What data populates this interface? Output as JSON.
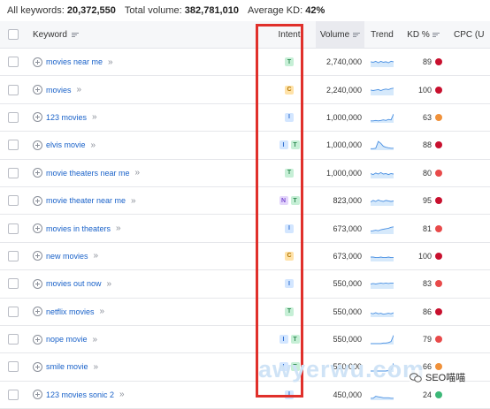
{
  "summary": {
    "keywords_label": "All keywords:",
    "keywords_value": "20,372,550",
    "volume_label": "Total volume:",
    "volume_value": "382,781,010",
    "kd_label": "Average KD:",
    "kd_value": "42%"
  },
  "headers": {
    "keyword": "Keyword",
    "intent": "Intent",
    "volume": "Volume",
    "trend": "Trend",
    "kd": "KD %",
    "cpc": "CPC (U"
  },
  "intent_colors": {
    "T": {
      "bg": "#c6efd6",
      "fg": "#2f8a52"
    },
    "C": {
      "bg": "#ffe2a8",
      "fg": "#b07500"
    },
    "I": {
      "bg": "#d3e6ff",
      "fg": "#2f6fd1"
    },
    "N": {
      "bg": "#e4d6fb",
      "fg": "#7a4bd1"
    }
  },
  "rows": [
    {
      "keyword": "movies near me",
      "intents": [
        "T"
      ],
      "volume": "2,740,000",
      "kd": "89",
      "kd_color": "#c8102e",
      "trend": [
        0.55,
        0.5,
        0.6,
        0.45,
        0.6,
        0.5,
        0.55,
        0.45,
        0.6,
        0.55
      ]
    },
    {
      "keyword": "movies",
      "intents": [
        "C"
      ],
      "volume": "2,240,000",
      "kd": "100",
      "kd_color": "#c8102e",
      "trend": [
        0.55,
        0.5,
        0.55,
        0.6,
        0.5,
        0.6,
        0.65,
        0.6,
        0.7,
        0.75
      ]
    },
    {
      "keyword": "123 movies",
      "intents": [
        "I"
      ],
      "volume": "1,000,000",
      "kd": "63",
      "kd_color": "#f0913a",
      "trend": [
        0.2,
        0.2,
        0.25,
        0.2,
        0.25,
        0.3,
        0.25,
        0.35,
        0.3,
        0.9
      ]
    },
    {
      "keyword": "elvis movie",
      "intents": [
        "I",
        "T"
      ],
      "volume": "1,000,000",
      "kd": "88",
      "kd_color": "#c8102e",
      "trend": [
        0.15,
        0.15,
        0.2,
        0.9,
        0.7,
        0.4,
        0.3,
        0.25,
        0.2,
        0.2
      ]
    },
    {
      "keyword": "movie theaters near me",
      "intents": [
        "T"
      ],
      "volume": "1,000,000",
      "kd": "80",
      "kd_color": "#e84a4a",
      "trend": [
        0.5,
        0.4,
        0.55,
        0.45,
        0.6,
        0.45,
        0.5,
        0.4,
        0.5,
        0.45
      ]
    },
    {
      "keyword": "movie theater near me",
      "intents": [
        "N",
        "T"
      ],
      "volume": "823,000",
      "kd": "95",
      "kd_color": "#c8102e",
      "trend": [
        0.4,
        0.55,
        0.45,
        0.6,
        0.5,
        0.45,
        0.55,
        0.5,
        0.45,
        0.5
      ]
    },
    {
      "keyword": "movies in theaters",
      "intents": [
        "I"
      ],
      "volume": "673,000",
      "kd": "81",
      "kd_color": "#e84a4a",
      "trend": [
        0.3,
        0.35,
        0.4,
        0.35,
        0.45,
        0.5,
        0.55,
        0.6,
        0.7,
        0.75
      ]
    },
    {
      "keyword": "new movies",
      "intents": [
        "C"
      ],
      "volume": "673,000",
      "kd": "100",
      "kd_color": "#c8102e",
      "trend": [
        0.45,
        0.45,
        0.4,
        0.4,
        0.45,
        0.4,
        0.4,
        0.45,
        0.4,
        0.4
      ]
    },
    {
      "keyword": "movies out now",
      "intents": [
        "I"
      ],
      "volume": "550,000",
      "kd": "83",
      "kd_color": "#e84a4a",
      "trend": [
        0.5,
        0.55,
        0.5,
        0.55,
        0.6,
        0.55,
        0.6,
        0.55,
        0.6,
        0.6
      ]
    },
    {
      "keyword": "netflix movies",
      "intents": [
        "T"
      ],
      "volume": "550,000",
      "kd": "86",
      "kd_color": "#c8102e",
      "trend": [
        0.4,
        0.35,
        0.45,
        0.35,
        0.4,
        0.3,
        0.35,
        0.4,
        0.35,
        0.45
      ]
    },
    {
      "keyword": "nope movie",
      "intents": [
        "I",
        "T"
      ],
      "volume": "550,000",
      "kd": "79",
      "kd_color": "#e84a4a",
      "trend": [
        0.1,
        0.1,
        0.1,
        0.1,
        0.1,
        0.15,
        0.15,
        0.2,
        0.3,
        0.95
      ]
    },
    {
      "keyword": "smile movie",
      "intents": [
        "I",
        "T"
      ],
      "volume": "550,000",
      "kd": "66",
      "kd_color": "#f0913a",
      "trend": [
        0.1,
        0.1,
        0.1,
        0.1,
        0.1,
        0.1,
        0.1,
        0.15,
        0.2,
        0.9
      ]
    },
    {
      "keyword": "123 movies sonic 2",
      "intents": [
        "I"
      ],
      "volume": "450,000",
      "kd": "24",
      "kd_color": "#3cb878",
      "trend": [
        0.2,
        0.2,
        0.4,
        0.35,
        0.3,
        0.25,
        0.25,
        0.25,
        0.2,
        0.2
      ]
    }
  ],
  "watermark": "awyerwu.com",
  "wechat_label": "SEO喵喵"
}
